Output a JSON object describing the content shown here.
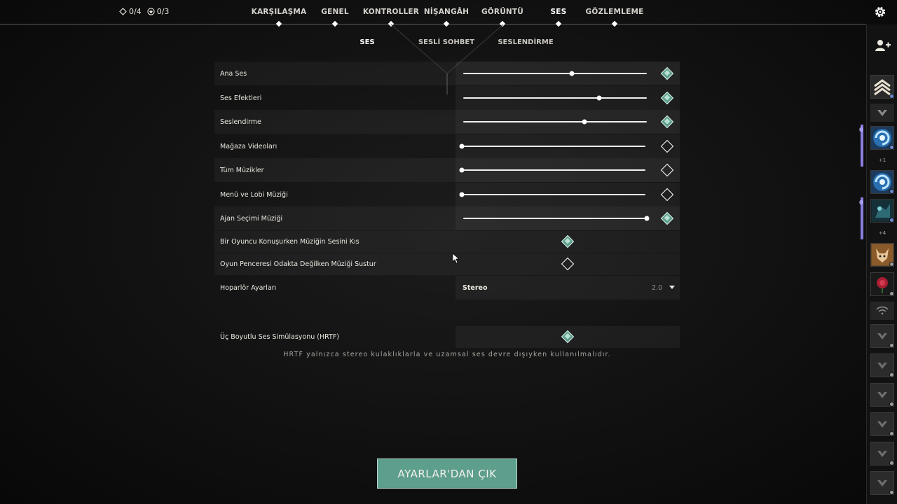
{
  "header": {
    "counters": [
      {
        "icon": "agent-token-icon",
        "value": "0/4"
      },
      {
        "icon": "star-token-icon",
        "value": "0/3"
      }
    ],
    "tabs": [
      {
        "id": "karsilasma",
        "label": "KARŞILAŞMA"
      },
      {
        "id": "genel",
        "label": "GENEL"
      },
      {
        "id": "kontroller",
        "label": "KONTROLLER"
      },
      {
        "id": "nisangah",
        "label": "NİŞANGÂH"
      },
      {
        "id": "goruntu",
        "label": "GÖRÜNTÜ"
      },
      {
        "id": "ses",
        "label": "SES",
        "active": true
      },
      {
        "id": "gozlemleme",
        "label": "GÖZLEMLEME"
      }
    ],
    "subtabs": [
      {
        "id": "ses",
        "label": "SES",
        "active": true
      },
      {
        "id": "sesli-sohbet",
        "label": "SESLİ SOHBET"
      },
      {
        "id": "seslendirme",
        "label": "SESLENDİRME"
      }
    ]
  },
  "settings": {
    "sliders": [
      {
        "id": "ana-ses",
        "label": "Ana Ses",
        "value": 0.59,
        "enabled": true
      },
      {
        "id": "ses-efektleri",
        "label": "Ses Efektleri",
        "value": 0.74,
        "enabled": true
      },
      {
        "id": "seslendirme",
        "label": "Seslendirme",
        "value": 0.66,
        "enabled": true
      },
      {
        "id": "magaza-videolari",
        "label": "Mağaza Videoları",
        "value": 0.0,
        "enabled": false
      },
      {
        "id": "tum-muzikler",
        "label": "Tüm Müzikler",
        "value": 0.0,
        "enabled": false
      },
      {
        "id": "menu-lobi-muzigi",
        "label": "Menü ve Lobi Müziği",
        "value": 0.0,
        "enabled": false
      },
      {
        "id": "ajan-secimi-muzigi",
        "label": "Ajan Seçimi Müziği",
        "value": 1.0,
        "enabled": true
      }
    ],
    "toggles": [
      {
        "id": "mute-music-speaking",
        "label": "Bir Oyuncu Konuşurken Müziğin Sesini Kıs",
        "enabled": true
      },
      {
        "id": "mute-music-unfocused",
        "label": "Oyun Penceresi Odakta Değilken Müziği Sustur",
        "enabled": false
      }
    ],
    "speaker": {
      "label": "Hoparlör Ayarları",
      "value": "Stereo",
      "channels": "2.0"
    },
    "hrtf": {
      "label": "Üç Boyutlu Ses Simülasyonu (HRTF)",
      "enabled": true,
      "note": "HRTF yalnızca stereo kulaklıklarla ve uzamsal ses devre dışıyken kullanılmalıdır."
    }
  },
  "footer": {
    "exit_label": "AYARLAR'DAN ÇIK"
  },
  "sidebar": {
    "party_counts": [
      "0",
      "0"
    ],
    "plus_labels": [
      "+1",
      "+4"
    ]
  },
  "colors": {
    "accent": "#5d9e8c",
    "party": "#8a7de0",
    "text": "#ece8e1"
  }
}
